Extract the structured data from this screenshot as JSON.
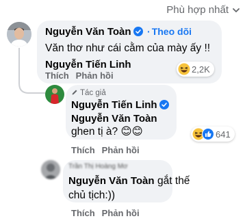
{
  "sort": {
    "label": "Phù hợp nhất"
  },
  "comment1": {
    "author": "Nguyễn Văn Toàn",
    "follow_separator": "·",
    "follow_label": "Theo dõi",
    "text": "Văn thơ như cái cằm của mày ấy !!",
    "tag": "Nguyễn Tiến Linh",
    "reactions": "2,2K",
    "like_label": "Thích",
    "reply_label": "Phản hồi"
  },
  "comment2": {
    "badge": "Tác giả",
    "author": "Nguyễn Tiến Linh",
    "tag": "Nguyễn Văn Toàn",
    "text": "ghen tị à? 😊😊",
    "reactions": "641",
    "like_label": "Thích",
    "reply_label": "Phản hồi"
  },
  "comment3": {
    "author": "Trần Thị Hoàng Mơ",
    "tag": "Nguyễn Văn Toàn",
    "text_line1": "gắt thế",
    "text_line2": "chủ tịch:))",
    "like_label": "Thích",
    "reply_label": "Phản hồi"
  },
  "colors": {
    "accent": "#1877f2",
    "bubble": "#f0f2f5",
    "muted": "#65676b"
  }
}
